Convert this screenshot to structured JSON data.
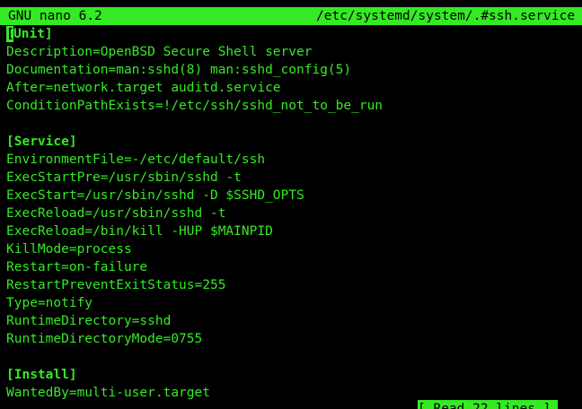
{
  "title_bar": {
    "app_name": "GNU nano 6.2",
    "file_path": "/etc/systemd/system/.#ssh.service"
  },
  "editor": {
    "cursor_char": "[",
    "lines": [
      "Unit]",
      "Description=OpenBSD Secure Shell server",
      "Documentation=man:sshd(8) man:sshd_config(5)",
      "After=network.target auditd.service",
      "ConditionPathExists=!/etc/ssh/sshd_not_to_be_run",
      "",
      "[Service]",
      "EnvironmentFile=-/etc/default/ssh",
      "ExecStartPre=/usr/sbin/sshd -t",
      "ExecStart=/usr/sbin/sshd -D $SSHD_OPTS",
      "ExecReload=/usr/sbin/sshd -t",
      "ExecReload=/bin/kill -HUP $MAINPID",
      "KillMode=process",
      "Restart=on-failure",
      "RestartPreventExitStatus=255",
      "Type=notify",
      "RuntimeDirectory=sshd",
      "RuntimeDirectoryMode=0755",
      "",
      "[Install]",
      "WantedBy=multi-user.target"
    ]
  },
  "status": {
    "message": "[ Read 22 lines ]"
  },
  "colors": {
    "foreground": "#35ea25",
    "background": "#000000"
  }
}
